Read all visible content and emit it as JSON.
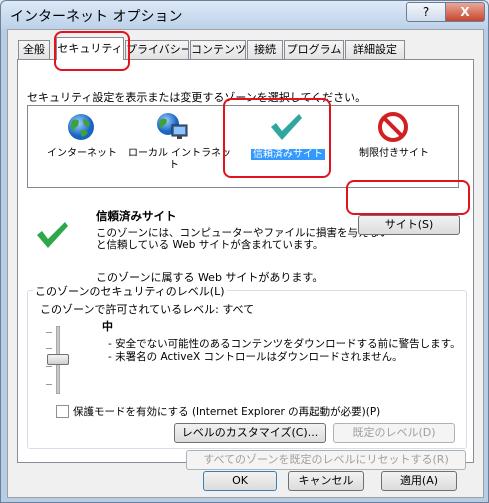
{
  "window": {
    "title": "インターネット オプション",
    "help": "?",
    "close": "X"
  },
  "tabs": [
    {
      "label": "全般"
    },
    {
      "label": "セキュリティ",
      "active": true
    },
    {
      "label": "プライバシー"
    },
    {
      "label": "コンテンツ"
    },
    {
      "label": "接続"
    },
    {
      "label": "プログラム"
    },
    {
      "label": "詳細設定"
    }
  ],
  "security": {
    "instruction": "セキュリティ設定を表示または変更するゾーンを選択してください。",
    "zones": [
      {
        "label_line1": "インターネット",
        "label_line2": "",
        "icon": "globe-icon"
      },
      {
        "label_line1": "ローカル イントラネッ",
        "label_line2": "ト",
        "icon": "intranet-icon"
      },
      {
        "label_line1": "信頼済みサイト",
        "label_line2": "",
        "icon": "checkmark-icon",
        "selected": true
      },
      {
        "label_line1": "制限付きサイト",
        "label_line2": "",
        "icon": "restricted-icon"
      }
    ],
    "zone_title": "信頼済みサイト",
    "zone_desc_line1": "このゾーンには、コンピューターやファイルに損害を与えない",
    "zone_desc_line2": "と信頼している Web サイトが含まれています。",
    "sites_button": "サイト(S)",
    "zone_note": "このゾーンに属する Web サイトがあります。",
    "level_group_label": "このゾーンのセキュリティのレベル(L)",
    "allowed_levels": "このゾーンで許可されているレベル: すべて",
    "level_name": "中",
    "level_bullet1": "- 安全でない可能性のあるコンテンツをダウンロードする前に警告します。",
    "level_bullet2": "- 未署名の ActiveX コントロールはダウンロードされません。",
    "protected_mode": "保護モードを有効にする (Internet Explorer の再起動が必要)(P)",
    "protected_mode_checked": false,
    "custom_level_button": "レベルのカスタマイズ(C)...",
    "default_level_button": "既定のレベル(D)",
    "reset_all_button": "すべてのゾーンを既定のレベルにリセットする(R)"
  },
  "footer": {
    "ok": "OK",
    "cancel": "キャンセル",
    "apply": "適用(A)"
  },
  "colors": {
    "highlight": "#3399ff",
    "annotation_red": "#e0141e",
    "check_green": "#2ea84a"
  }
}
